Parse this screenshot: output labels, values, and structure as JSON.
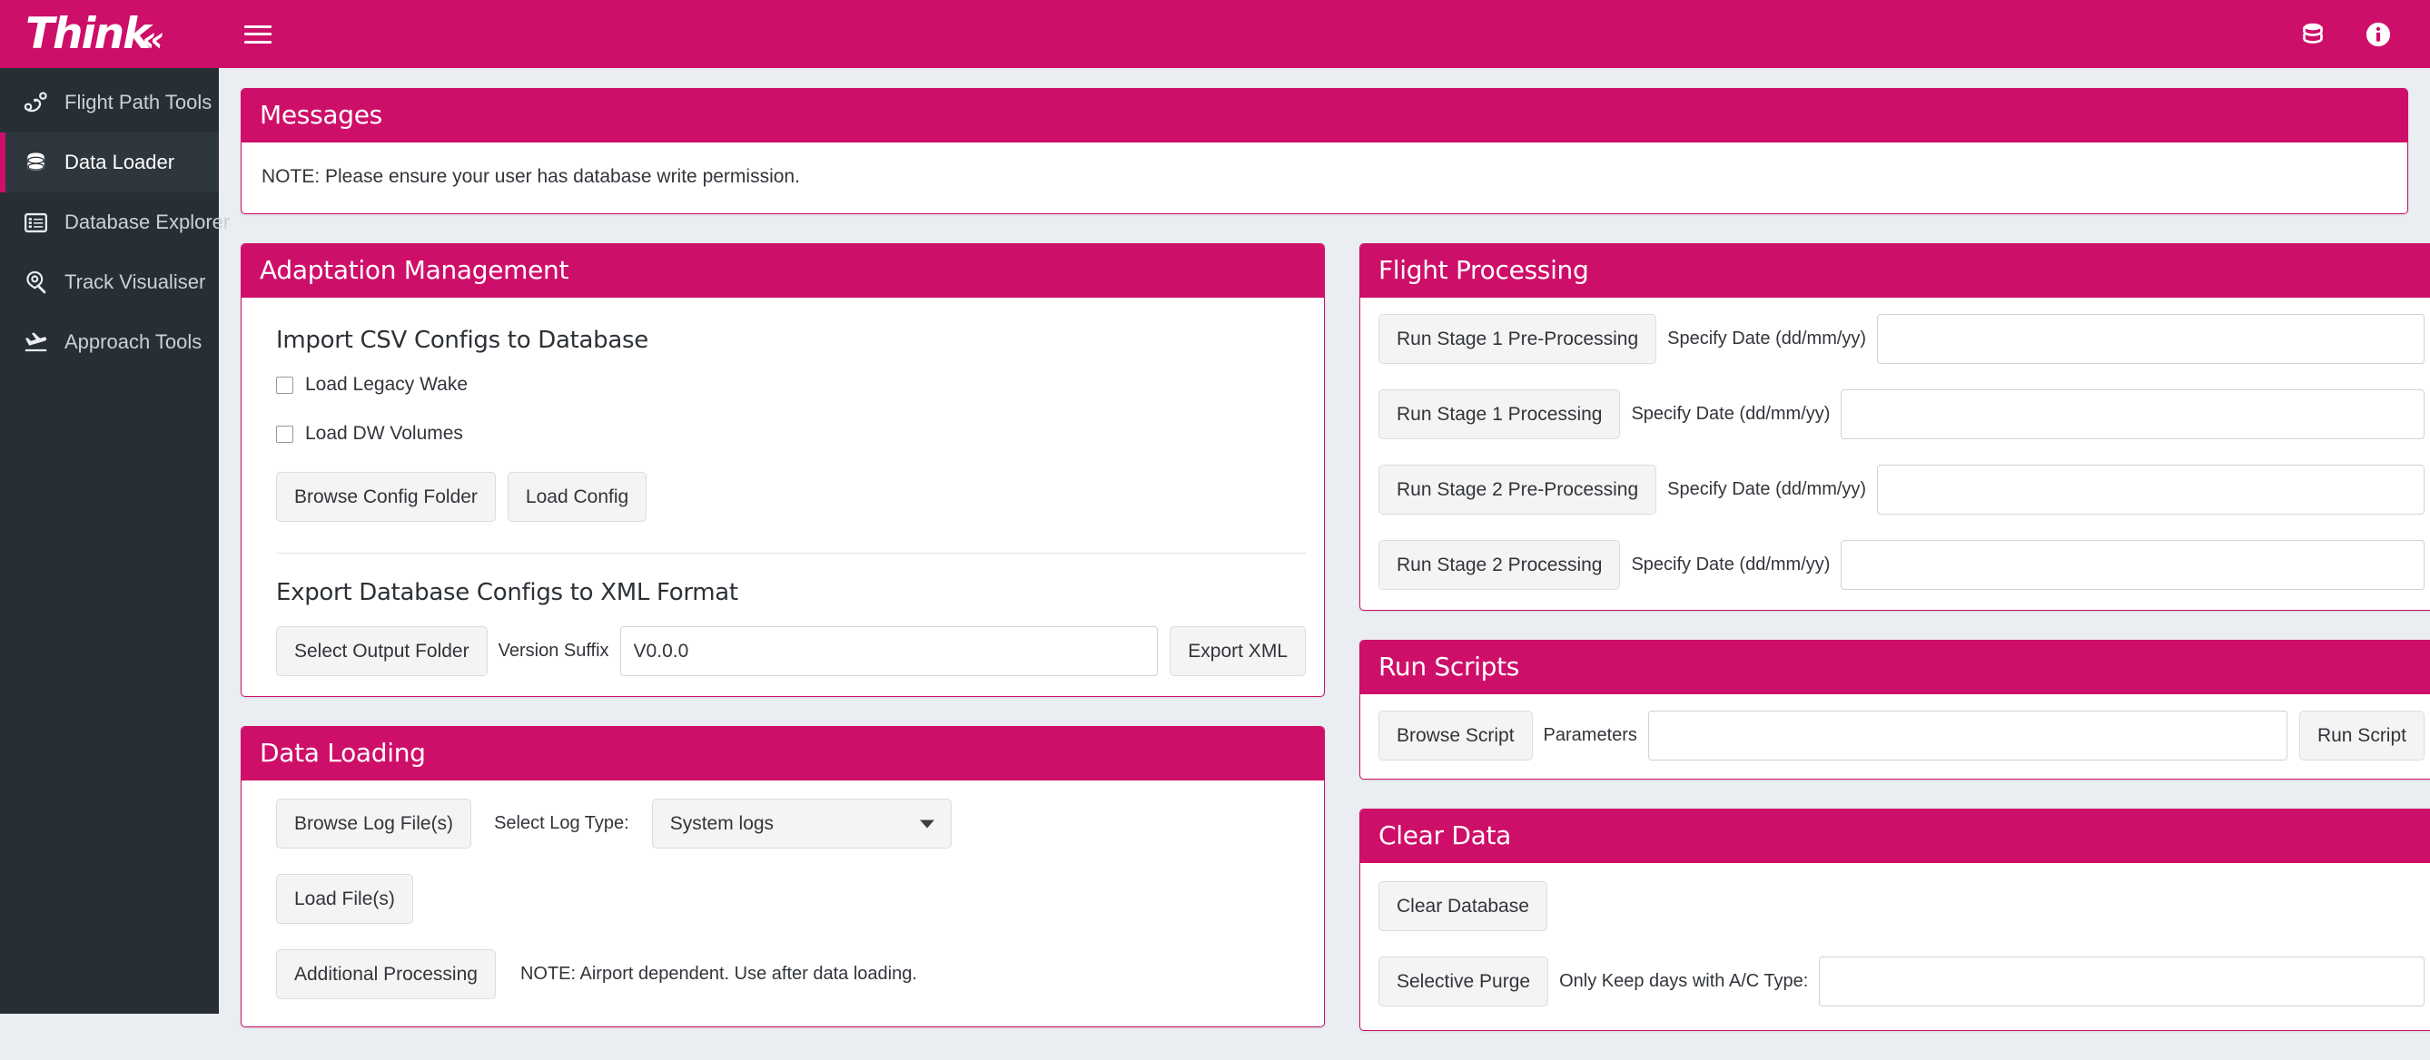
{
  "app": {
    "logo_text": "Think",
    "logo_chevron": "«"
  },
  "topbar": {
    "menu_icon": "hamburger-icon",
    "database_icon": "database-icon",
    "info_icon": "info-icon"
  },
  "sidebar": {
    "items": [
      {
        "label": "Flight Path Tools",
        "icon": "route-icon",
        "active": false
      },
      {
        "label": "Data Loader",
        "icon": "database-icon",
        "active": true
      },
      {
        "label": "Database Explorer",
        "icon": "table-list-icon",
        "active": false
      },
      {
        "label": "Track Visualiser",
        "icon": "map-search-icon",
        "active": false
      },
      {
        "label": "Approach Tools",
        "icon": "plane-landing-icon",
        "active": false
      }
    ]
  },
  "messages": {
    "title": "Messages",
    "note": "NOTE: Please ensure your user has database write permission."
  },
  "adaptation": {
    "title": "Adaptation Management",
    "import_heading": "Import CSV Configs to Database",
    "checkboxes": [
      {
        "label": "Load Legacy Wake",
        "checked": false
      },
      {
        "label": "Load DW Volumes",
        "checked": false
      }
    ],
    "browse_config_label": "Browse Config Folder",
    "load_config_label": "Load Config",
    "export_heading": "Export Database Configs to XML Format",
    "select_output_label": "Select Output Folder",
    "version_suffix_label": "Version Suffix",
    "version_suffix_value": "V0.0.0",
    "export_xml_label": "Export XML"
  },
  "data_loading": {
    "title": "Data Loading",
    "browse_logs_label": "Browse Log File(s)",
    "select_log_type_label": "Select Log Type:",
    "log_type_value": "System logs",
    "log_type_options": [
      "System logs"
    ],
    "load_files_label": "Load File(s)",
    "additional_processing_label": "Additional Processing",
    "additional_note": "NOTE: Airport dependent. Use after data loading."
  },
  "flight_processing": {
    "title": "Flight Processing",
    "rows": [
      {
        "button": "Run Stage 1 Pre-Processing",
        "label": "Specify Date (dd/mm/yy)",
        "value": ""
      },
      {
        "button": "Run Stage 1 Processing",
        "label": "Specify Date (dd/mm/yy)",
        "value": ""
      },
      {
        "button": "Run Stage 2 Pre-Processing",
        "label": "Specify Date (dd/mm/yy)",
        "value": ""
      },
      {
        "button": "Run Stage 2 Processing",
        "label": "Specify Date (dd/mm/yy)",
        "value": ""
      }
    ]
  },
  "run_scripts": {
    "title": "Run Scripts",
    "browse_script_label": "Browse Script",
    "parameters_label": "Parameters",
    "parameters_value": "",
    "run_script_label": "Run Script"
  },
  "clear_data": {
    "title": "Clear Data",
    "clear_database_label": "Clear Database",
    "selective_purge_label": "Selective Purge",
    "only_keep_label": "Only Keep days with A/C Type:",
    "only_keep_value": ""
  },
  "colors": {
    "brand_pink": "#ce0f69",
    "sidebar_bg": "#272e35",
    "sidebar_active_bg": "#2e363e",
    "page_bg": "#eaedf1",
    "panel_bg": "#ffffff",
    "button_bg": "#f4f4f4"
  }
}
